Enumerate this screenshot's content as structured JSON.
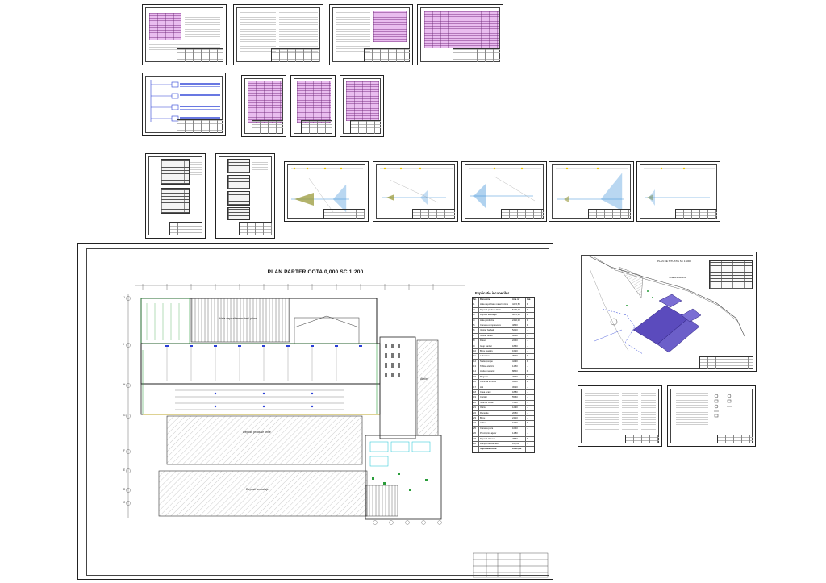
{
  "floor_plan": {
    "title": "PLAN PARTER COTA 0,000 SC 1:200",
    "zones": {
      "upper_hall": "Hala depozitare materii prime",
      "middle_warehouse": "Depozit produse finite",
      "lower_warehouse": "Depozit ambalaje",
      "side_room": "Atelier"
    },
    "legend": {
      "title": "Explicatie incaperilor",
      "headers": [
        "Nr.",
        "Denumire",
        "Aria m²",
        "Cat."
      ],
      "rows": [
        [
          "1",
          "Hala depozitare materii prime",
          "4215,50",
          "D"
        ],
        [
          "2",
          "Depozit produse finite",
          "5130,20",
          "D"
        ],
        [
          "3",
          "Depozit ambalaje",
          "3870,10",
          "D"
        ],
        [
          "4",
          "Hala productie",
          "2450,00",
          "D"
        ],
        [
          "5",
          "Camera compresoare",
          "48,30",
          "D"
        ],
        [
          "6",
          "Vestiar barbati",
          "52,10",
          "-"
        ],
        [
          "7",
          "Vestiar femei",
          "46,80",
          "-"
        ],
        [
          "8",
          "Dusuri",
          "22,40",
          "-"
        ],
        [
          "9",
          "Grup sanitar",
          "18,60",
          "-"
        ],
        [
          "10",
          "Birou maistru",
          "16,20",
          "-"
        ],
        [
          "11",
          "Laborator",
          "35,70",
          "D"
        ],
        [
          "12",
          "Statie pompe",
          "42,90",
          "D"
        ],
        [
          "13",
          "Tablou electric",
          "14,50",
          "-"
        ],
        [
          "14",
          "Atelier mecanic",
          "88,40",
          "D"
        ],
        [
          "15",
          "Magazie",
          "26,30",
          "D"
        ],
        [
          "16",
          "Centrala termica",
          "64,00",
          "D"
        ],
        [
          "17",
          "Hol",
          "30,20",
          "-"
        ],
        [
          "18",
          "Casa scarii",
          "18,80",
          "-"
        ],
        [
          "19",
          "Coridor",
          "55,60",
          "-"
        ],
        [
          "20",
          "Sala de mese",
          "72,40",
          "-"
        ],
        [
          "21",
          "Oficiu",
          "12,90",
          "-"
        ],
        [
          "22",
          "Receptie",
          "20,50",
          "-"
        ],
        [
          "23",
          "Birou",
          "24,10",
          "-"
        ],
        [
          "24",
          "Arhiva",
          "16,70",
          "D"
        ],
        [
          "25",
          "Camera paza",
          "10,40",
          "-"
        ],
        [
          "26",
          "Punct prim ajutor",
          "14,80",
          "-"
        ],
        [
          "27",
          "Depozit deseuri",
          "28,60",
          "D"
        ],
        [
          "28",
          "Rampa descarcare",
          "120,00",
          "-"
        ]
      ],
      "total_label": "Suprafata totala",
      "total_value": "16665,98"
    },
    "grid_letters": [
      "J",
      "I",
      "H",
      "G",
      "F",
      "E",
      "D",
      "C",
      "B",
      "A"
    ]
  },
  "site_plan": {
    "title": "PLAN DE SITUATIE SC 1:1000",
    "road_label": "Strada existenta",
    "legend_headers": [
      "Nr.",
      "Denumire",
      "Aria"
    ]
  },
  "colors": {
    "line": "#222222",
    "pink_table": "#e9bcef",
    "plan_green": "#2a9d3a",
    "plan_blue": "#2a3fd6",
    "plan_cyan": "#19c3d4",
    "building_purple": "#5b4bbd",
    "triangle_olive": "#9a9a3a",
    "hatch_blue": "#3a8fd8"
  }
}
